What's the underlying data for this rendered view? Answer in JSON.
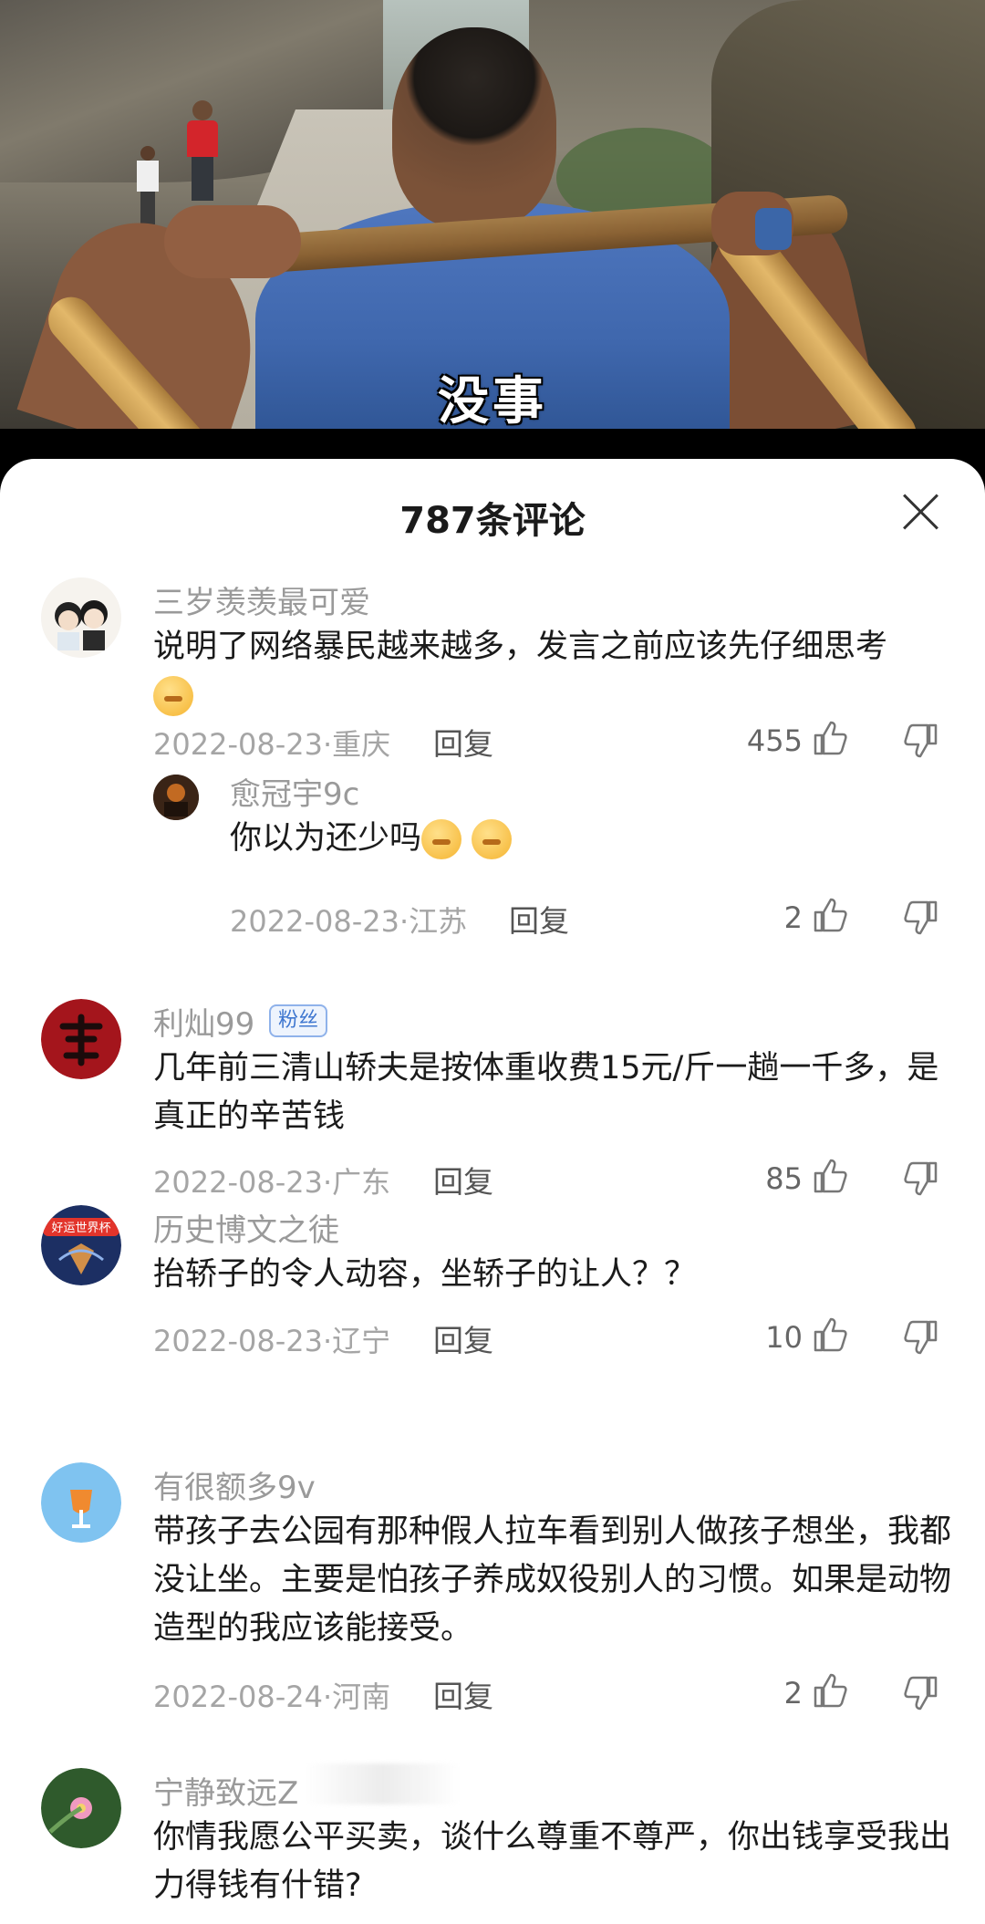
{
  "video": {
    "subtitle": "没事"
  },
  "sheet": {
    "title": "787条评论"
  },
  "comments": [
    {
      "username": "三岁羡羡最可爱",
      "text": "说明了网络暴民越来越多，发言之前应该先仔细思考",
      "emoji": "sweat-smile-emoji",
      "meta": "2022-08-23·重庆",
      "reply": "回复",
      "likes": "455"
    },
    {
      "username": "愈冠宇9c",
      "text": "你以为还少吗",
      "emoji": "scared-emoji",
      "meta": "2022-08-23·江苏",
      "reply": "回复",
      "likes": "2"
    },
    {
      "username": "利灿99",
      "badge": "粉丝",
      "text": "几年前三清山轿夫是按体重收费15元/斤一趟一千多，是真正的辛苦钱",
      "meta": "2022-08-23·广东",
      "reply": "回复",
      "likes": "85"
    },
    {
      "username": "历史博文之徒",
      "avatar_text": "好运世界杯",
      "text": "抬轿子的令人动容，坐轿子的让人？？",
      "meta": "2022-08-23·辽宁",
      "reply": "回复",
      "likes": "10"
    },
    {
      "username": "有很额多9v",
      "text": "带孩子去公园有那种假人拉车看到别人做孩子想坐，我都没让坐。主要是怕孩子养成奴役别人的习惯。如果是动物造型的我应该能接受。",
      "meta": "2022-08-24·河南",
      "reply": "回复",
      "likes": "2"
    },
    {
      "username": "宁静致远Z",
      "text": "你情我愿公平买卖，谈什么尊重不尊严，你出钱享受我出力得钱有什错?"
    }
  ],
  "colors": {
    "username": "#9a9a9a",
    "text": "#1b1b1b",
    "meta": "#a5a5a5",
    "badge": "#3f77d0"
  },
  "icons": {
    "like": "thumbs-up-icon",
    "dislike": "thumbs-down-icon",
    "close": "close-icon"
  }
}
